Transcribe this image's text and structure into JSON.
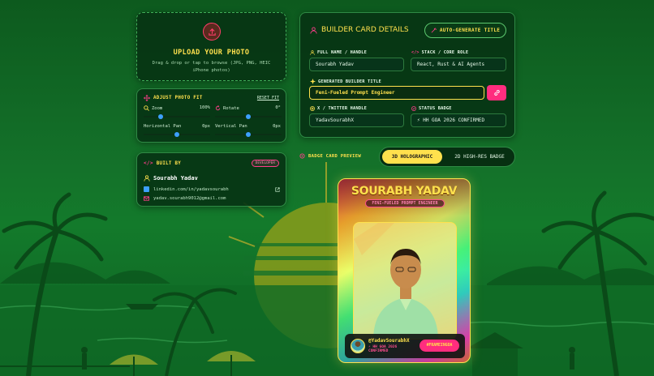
{
  "upload": {
    "title": "UPLOAD YOUR PHOTO",
    "subtitle": "Drag & drop or tap to browse (JPG, PNG, HEIC iPhone photos)"
  },
  "adjust": {
    "title": "ADJUST PHOTO FIT",
    "reset_label": "RESET FIT",
    "zoom": {
      "label": "Zoom",
      "value": "100%",
      "level": 0.25
    },
    "rotate": {
      "label": "Rotate",
      "value": "0°",
      "level": 0.5
    },
    "hpan": {
      "label": "Horizontal Pan",
      "value": "0px",
      "level": 0.5
    },
    "vpan": {
      "label": "Vertical Pan",
      "value": "0px",
      "level": 0.5
    }
  },
  "builtby": {
    "title": "BUILT BY",
    "badge": "DEVELOPER",
    "name": "Sourabh Yadav",
    "linkedin": "linkedin.com/in/yadavsourabh",
    "email": "yadav.sourabh9012@gmail.com"
  },
  "details": {
    "title": "BUILDER CARD DETAILS",
    "auto_button": "AUTO-GENERATE TITLE",
    "fields": {
      "name": {
        "label": "FULL NAME / HANDLE",
        "value": "Sourabh Yadav"
      },
      "stack": {
        "label": "STACK / CORE ROLE",
        "value": "React, Rust & AI Agents"
      },
      "title": {
        "label": "GENERATED BUILDER TITLE",
        "value": "Feni-Fueled Prompt Engineer"
      },
      "twitter": {
        "label": "X / TWITTER HANDLE",
        "value": "YadavSourabhX"
      },
      "status": {
        "label": "STATUS BADGE",
        "value": "⚡ HH GOA 2026 CONFIRMED"
      }
    }
  },
  "preview": {
    "label": "BADGE CARD PREVIEW",
    "toggle_on": "3D HOLOGRAPHIC",
    "toggle_off": "2D HIGH-RES BADGE"
  },
  "badge": {
    "name": "SOURABH YADAV",
    "title": "FENI-FUELED PROMPT ENGINEER",
    "handle": "@YadavSourabhX",
    "status": "⚡ HH GOA 2026 CONFIRMED",
    "tag": "#FRAMEINGOA"
  },
  "colors": {
    "accent_yellow": "#ffe14d",
    "accent_pink": "#ff2d7e",
    "bg_green": "#14722a",
    "panel_green": "#06341a"
  }
}
